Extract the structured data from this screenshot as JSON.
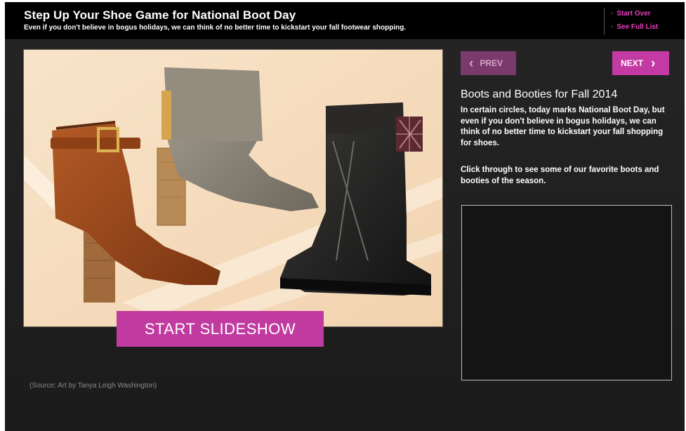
{
  "header": {
    "title": "Step Up Your Shoe Game for National Boot Day",
    "subtitle": "Even if you don't believe in bogus holidays, we can think of no better time to kickstart your fall footwear shopping.",
    "links": [
      {
        "label": "Start Over"
      },
      {
        "label": "See Full List"
      }
    ]
  },
  "slide": {
    "image_alt": "brown-boot, taupe-bootie, black-combat-boot",
    "button_label": "START SLIDESHOW",
    "caption": "(Source: Art by Tanya Leigh Washington)"
  },
  "nav": {
    "prev_label": "PREV",
    "next_label": "NEXT"
  },
  "description": {
    "title": "Boots and Booties for Fall 2014",
    "paragraph1": "In certain circles, today marks National Boot Day, but even if you don't believe in bogus holidays, we can think of no better time to kickstart your fall shopping for shoes.",
    "paragraph2": "Click through to see some of our favorite boots and booties of the season."
  },
  "colors": {
    "accent": "#c43aa3",
    "link": "#e83fbb",
    "header_bg": "#000000",
    "page_bg": "#1d1c1d"
  }
}
